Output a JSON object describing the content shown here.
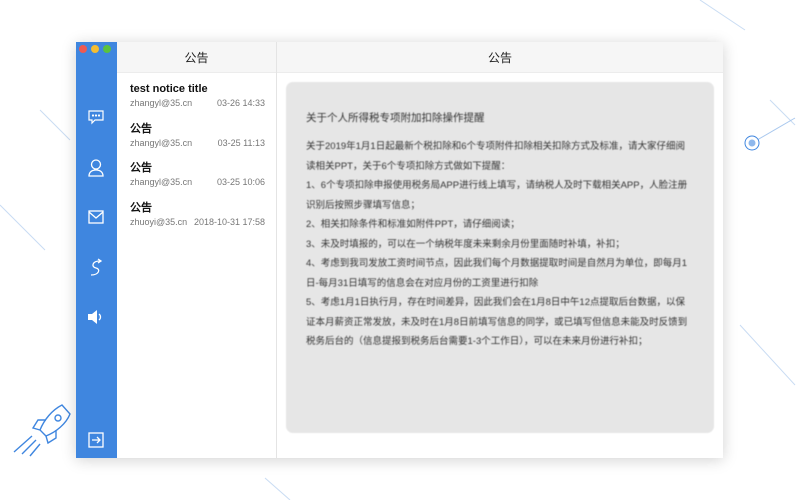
{
  "window": {
    "traffic_lights": [
      "#ee5a52",
      "#f5bd31",
      "#5ac23f"
    ]
  },
  "sidebar": {
    "color": "#3f86df",
    "items": [
      {
        "icon": "chat-icon"
      },
      {
        "icon": "user-icon"
      },
      {
        "icon": "mail-icon"
      },
      {
        "icon": "share-icon"
      },
      {
        "icon": "speaker-icon"
      }
    ],
    "logout_icon": "logout-icon"
  },
  "list": {
    "title": "公告",
    "items": [
      {
        "title": "test notice title",
        "sender": "zhangyl@35.cn",
        "time": "03-26 14:33"
      },
      {
        "title": "公告",
        "sender": "zhangyl@35.cn",
        "time": "03-25 11:13"
      },
      {
        "title": "公告",
        "sender": "zhangyl@35.cn",
        "time": "03-25 10:06"
      },
      {
        "title": "公告",
        "sender": "zhuoyi@35.cn",
        "time": "2018-10-31 17:58"
      }
    ]
  },
  "detail": {
    "title": "公告",
    "heading": "关于个人所得税专项附加扣除操作提醒",
    "paragraphs": [
      "关于2019年1月1日起最新个税扣除和6个专项附件扣除相关扣除方式及标准，请大家仔细阅读相关PPT，关于6个专项扣除方式做如下提醒：",
      "1、6个专项扣除申报使用税务局APP进行线上填写，请纳税人及时下载相关APP，人脸注册识别后按照步骤填写信息；",
      "2、相关扣除条件和标准如附件PPT，请仔细阅读；",
      "3、未及时填报的，可以在一个纳税年度未来剩余月份里面随时补填，补扣；",
      "4、考虑到我司发放工资时间节点，因此我们每个月数据提取时间是自然月为单位，即每月1日-每月31日填写的信息会在对应月份的工资里进行扣除",
      "5、考虑1月1日执行月，存在时间差异，因此我们会在1月8日中午12点提取后台数据，以保证本月薪资正常发放，未及时在1月8日前填写信息的同学，或已填写但信息未能及时反馈到税务后台的（信息提报到税务后台需要1-3个工作日），可以在未来月份进行补扣；"
    ]
  }
}
